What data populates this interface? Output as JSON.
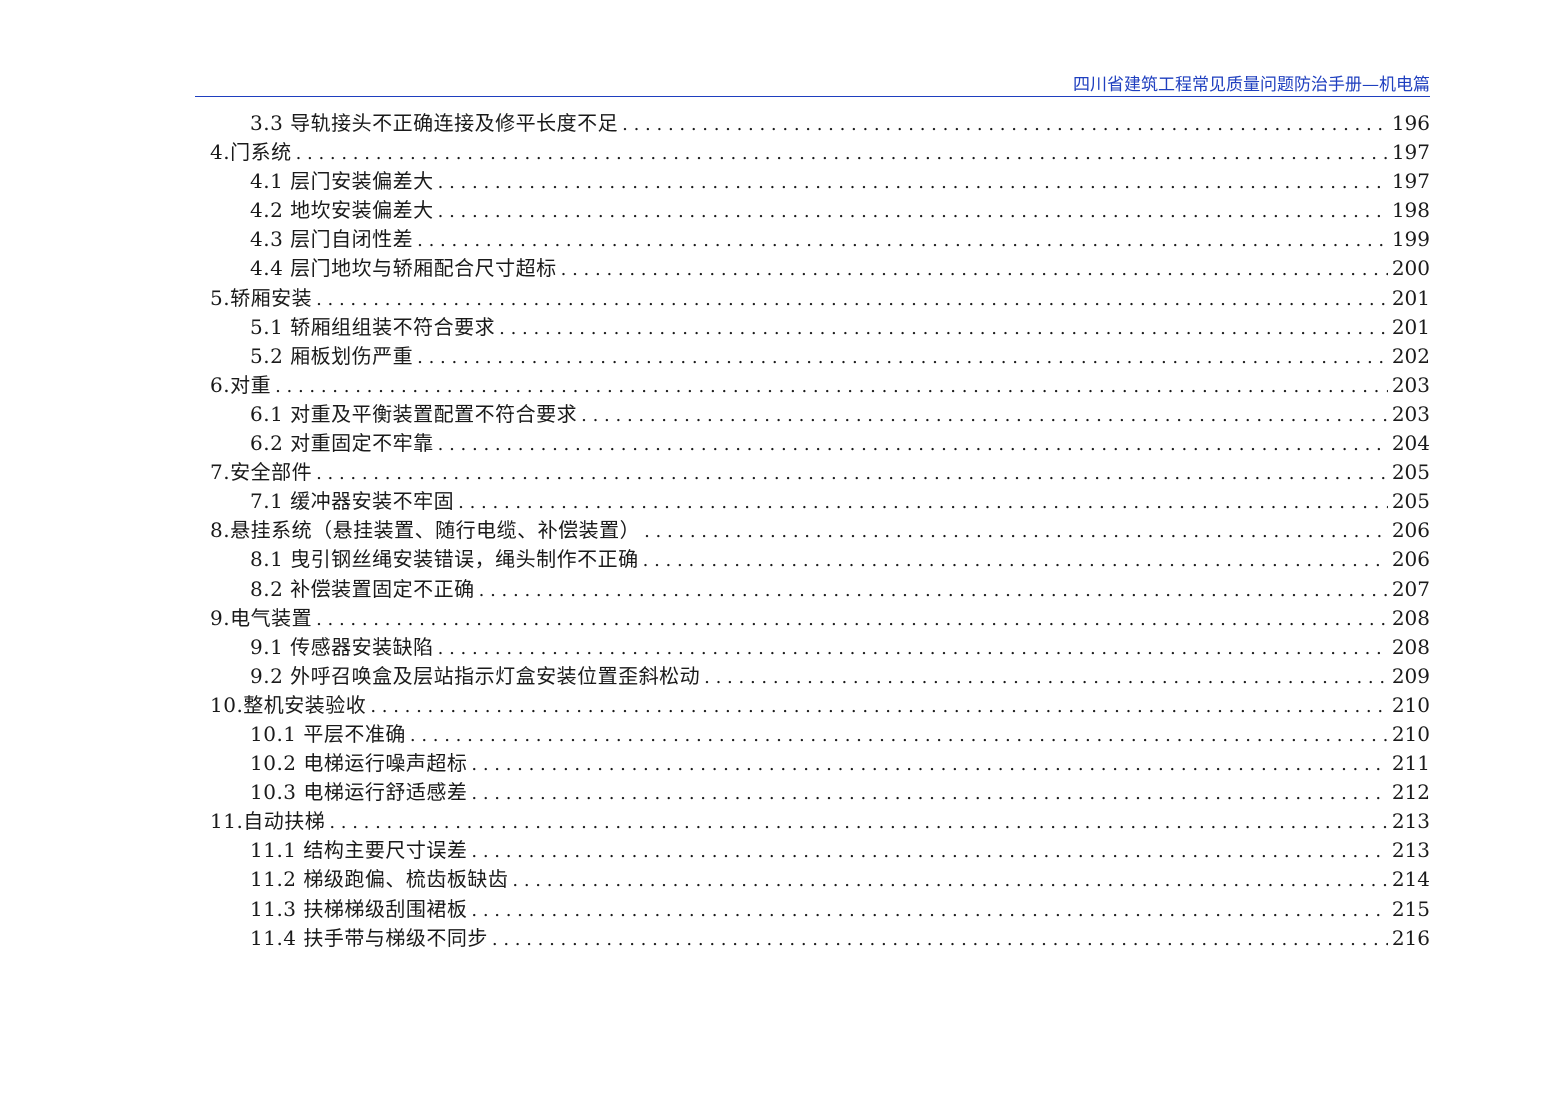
{
  "header": {
    "title": "四川省建筑工程常见质量问题防治手册—机电篇"
  },
  "toc": [
    {
      "level": 2,
      "title": "3.3 导轨接头不正确连接及修平长度不足",
      "page": "196"
    },
    {
      "level": 1,
      "title": "4.门系统",
      "page": "197"
    },
    {
      "level": 2,
      "title": "4.1 层门安装偏差大",
      "page": "197"
    },
    {
      "level": 2,
      "title": "4.2 地坎安装偏差大",
      "page": "198"
    },
    {
      "level": 2,
      "title": "4.3 层门自闭性差",
      "page": "199"
    },
    {
      "level": 2,
      "title": "4.4 层门地坎与轿厢配合尺寸超标",
      "page": "200"
    },
    {
      "level": 1,
      "title": "5.轿厢安装",
      "page": "201"
    },
    {
      "level": 2,
      "title": "5.1 轿厢组组装不符合要求",
      "page": "201"
    },
    {
      "level": 2,
      "title": "5.2 厢板划伤严重",
      "page": "202"
    },
    {
      "level": 1,
      "title": "6.对重",
      "page": "203"
    },
    {
      "level": 2,
      "title": "6.1 对重及平衡装置配置不符合要求",
      "page": "203"
    },
    {
      "level": 2,
      "title": "6.2 对重固定不牢靠",
      "page": "204"
    },
    {
      "level": 1,
      "title": "7.安全部件",
      "page": "205"
    },
    {
      "level": 2,
      "title": "7.1 缓冲器安装不牢固",
      "page": "205"
    },
    {
      "level": 1,
      "title": "8.悬挂系统（悬挂装置、随行电缆、补偿装置）",
      "page": "206"
    },
    {
      "level": 2,
      "title": "8.1 曳引钢丝绳安装错误，绳头制作不正确",
      "page": "206"
    },
    {
      "level": 2,
      "title": "8.2 补偿装置固定不正确",
      "page": "207"
    },
    {
      "level": 1,
      "title": "9.电气装置",
      "page": "208"
    },
    {
      "level": 2,
      "title": "9.1 传感器安装缺陷",
      "page": "208"
    },
    {
      "level": 2,
      "title": "9.2 外呼召唤盒及层站指示灯盒安装位置歪斜松动",
      "page": "209"
    },
    {
      "level": 1,
      "title": "10.整机安装验收",
      "page": "210"
    },
    {
      "level": 2,
      "title": "10.1 平层不准确",
      "page": "210"
    },
    {
      "level": 2,
      "title": "10.2 电梯运行噪声超标",
      "page": "211"
    },
    {
      "level": 2,
      "title": "10.3 电梯运行舒适感差",
      "page": "212"
    },
    {
      "level": 1,
      "title": "11.自动扶梯",
      "page": "213"
    },
    {
      "level": 2,
      "title": "11.1 结构主要尺寸误差",
      "page": "213"
    },
    {
      "level": 2,
      "title": "11.2 梯级跑偏、梳齿板缺齿",
      "page": "214"
    },
    {
      "level": 2,
      "title": "11.3 扶梯梯级刮围裙板",
      "page": "215"
    },
    {
      "level": 2,
      "title": "11.4 扶手带与梯级不同步",
      "page": "216"
    }
  ]
}
